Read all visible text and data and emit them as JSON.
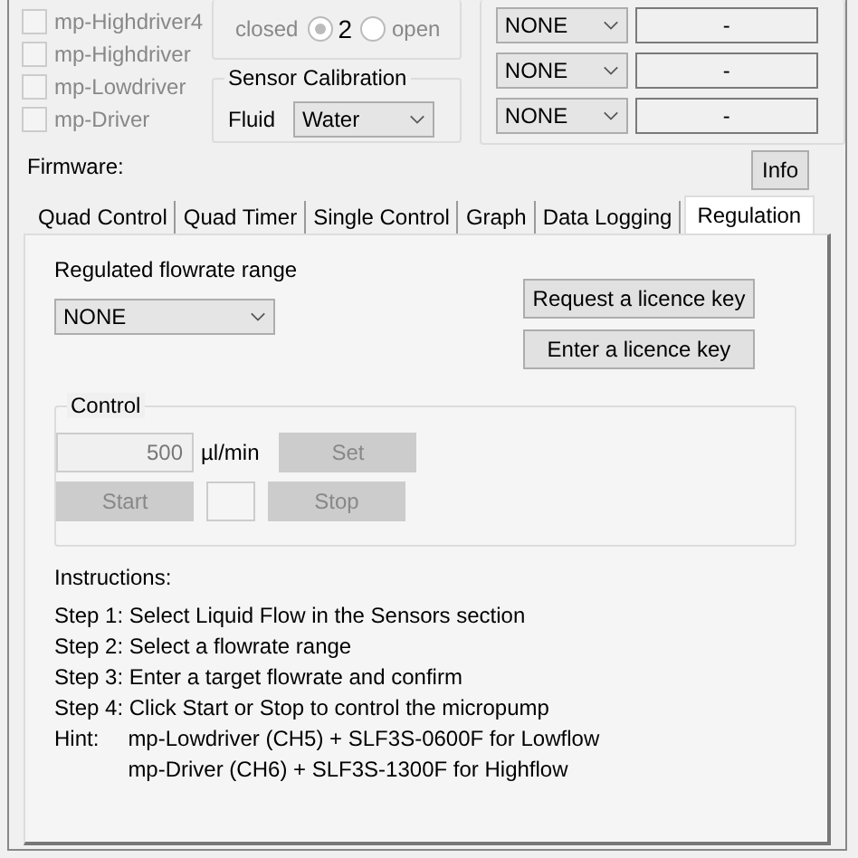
{
  "drivers": [
    {
      "label": "mp-Highdriver4",
      "checked": false,
      "disabled": true
    },
    {
      "label": "mp-Highdriver",
      "checked": false,
      "disabled": true
    },
    {
      "label": "mp-Lowdriver",
      "checked": false,
      "disabled": true
    },
    {
      "label": "mp-Driver",
      "checked": false,
      "disabled": true
    }
  ],
  "loop": {
    "label": "closed",
    "radios": [
      {
        "label": "2",
        "selected": true
      },
      {
        "label": "open",
        "selected": false
      }
    ]
  },
  "calibration": {
    "title": "Sensor Calibration",
    "fluid_label": "Fluid",
    "fluid": "Water"
  },
  "sensors": [
    {
      "type": "NONE",
      "value": "-"
    },
    {
      "type": "NONE",
      "value": "-"
    },
    {
      "type": "NONE",
      "value": "-"
    }
  ],
  "firmware_label": "Firmware:",
  "info_button": "Info",
  "tabs": [
    {
      "label": "Quad Control",
      "selected": false
    },
    {
      "label": "Quad Timer",
      "selected": false
    },
    {
      "label": "Single Control",
      "selected": false
    },
    {
      "label": "Graph",
      "selected": false
    },
    {
      "label": "Data Logging",
      "selected": false
    },
    {
      "label": "Regulation",
      "selected": true
    }
  ],
  "regulation": {
    "range_label": "Regulated flowrate range",
    "range": "NONE",
    "buttons": [
      "Request a licence key",
      "Enter a licence key"
    ],
    "control": {
      "title": "Control",
      "flowrate": "500",
      "unit": "µl/min",
      "set": "Set",
      "start": "Start",
      "stop": "Stop",
      "disabled": true
    },
    "instructions": {
      "title": "Instructions:",
      "steps": [
        "Step 1: Select Liquid Flow in the Sensors section",
        "Step 2: Select a flowrate range",
        "Step 3: Enter a target flowrate and confirm",
        "Step 4: Click Start or Stop to control the micropump"
      ],
      "hint_label": "Hint:",
      "hint_lines": [
        "mp-Lowdriver (CH5) + SLF3S-0600F for Lowflow",
        "mp-Driver (CH6) + SLF3S-1300F for Highflow"
      ]
    }
  }
}
